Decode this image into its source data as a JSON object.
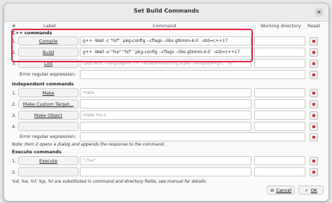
{
  "window": {
    "title": "Set Build Commands"
  },
  "headers": {
    "num": "#",
    "label": "Label",
    "command": "Command",
    "workdir": "Working directory",
    "reset": "Reset"
  },
  "cpp": {
    "section": "C++ commands",
    "rows": [
      {
        "num": "1.",
        "label": "Compile",
        "command": "g++ -Wall -c \"%f\" `pkg-config --cflags --libs gtkmm-4.0` -std=c++17",
        "workdir": ""
      },
      {
        "num": "2.",
        "label": "Build",
        "command": "g++ -Wall -o \"%e\" \"%f\" `pkg-config --cflags --libs gtkmm-4.0` -std=c++17",
        "workdir": ""
      },
      {
        "num": "3.",
        "label": "Lint",
        "command": "cppcheck --language=c++ --enable=warning,style --template=gcc \"%f\"",
        "workdir": ""
      }
    ],
    "error_label": "Error regular expression:",
    "error_value": ""
  },
  "independent": {
    "section": "Independent commands",
    "rows": [
      {
        "num": "1.",
        "label": "Make",
        "command": "make",
        "workdir": ""
      },
      {
        "num": "2.",
        "label": "Make Custom Target...",
        "command": "",
        "workdir": ""
      },
      {
        "num": "3.",
        "label": "Make Object",
        "command": "make %e.o",
        "workdir": ""
      },
      {
        "num": "4.",
        "label": "",
        "command": "",
        "workdir": ""
      }
    ],
    "error_label": "Error regular expression:",
    "error_value": ""
  },
  "note": "Note: Item 2 opens a dialog and appends the response to the command.",
  "execute": {
    "section": "Execute commands",
    "rows": [
      {
        "num": "1.",
        "label": "Execute",
        "command": "\"./%e\"",
        "workdir": ""
      },
      {
        "num": "2.",
        "label": "",
        "command": "",
        "workdir": ""
      }
    ]
  },
  "footnote": "%d, %e, %f, %p, %l are substituted in command and directory fields, see manual for details.",
  "footer": {
    "cancel": "Cancel",
    "ok": "OK"
  },
  "colors": {
    "highlight": "#e0213a",
    "reset_icon": "#c0392b"
  }
}
